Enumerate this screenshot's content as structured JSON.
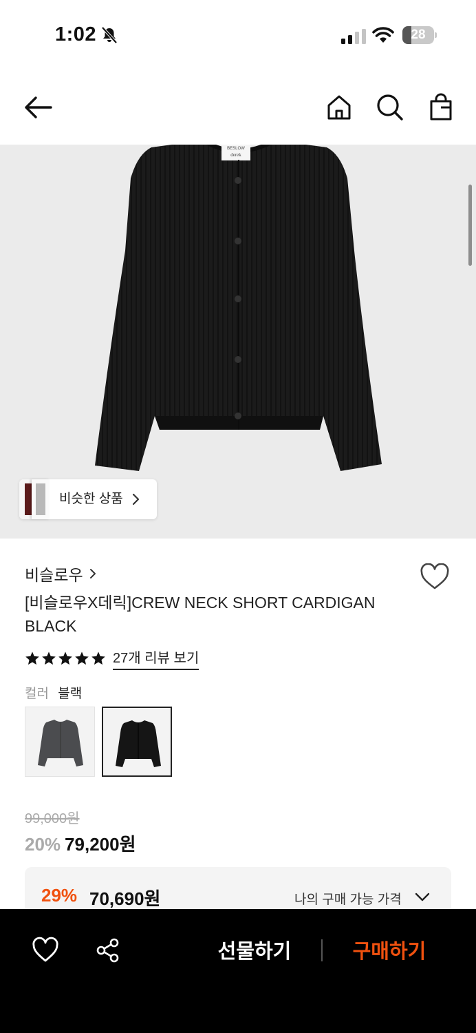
{
  "status_bar": {
    "time": "1:02",
    "battery": "28",
    "battery_level": 0.28
  },
  "nav": {
    "icons": [
      "back-arrow-icon",
      "home-icon",
      "search-icon",
      "shopping-bag-icon"
    ]
  },
  "hero": {
    "similar_label": "비슷한 상품"
  },
  "product": {
    "brand": "비슬로우",
    "title": "[비슬로우X데릭]CREW NECK SHORT CARDIGAN BLACK",
    "rating_stars": 5,
    "review_link": "27개 리뷰 보기",
    "color_label": "컬러",
    "color_value": "블랙",
    "color_options": [
      "charcoal",
      "black"
    ]
  },
  "price": {
    "original": "99,000원",
    "discount": "20%",
    "sale": "79,200원"
  },
  "my_price": {
    "discount": "29%",
    "price": "70,690원",
    "label": "나의 구매 가능 가격"
  },
  "bottom_bar": {
    "gift": "선물하기",
    "buy": "구매하기"
  },
  "colors": {
    "accent": "#f0510f",
    "hero_bg": "#ebebeb",
    "bottom_bar": "#000000"
  }
}
